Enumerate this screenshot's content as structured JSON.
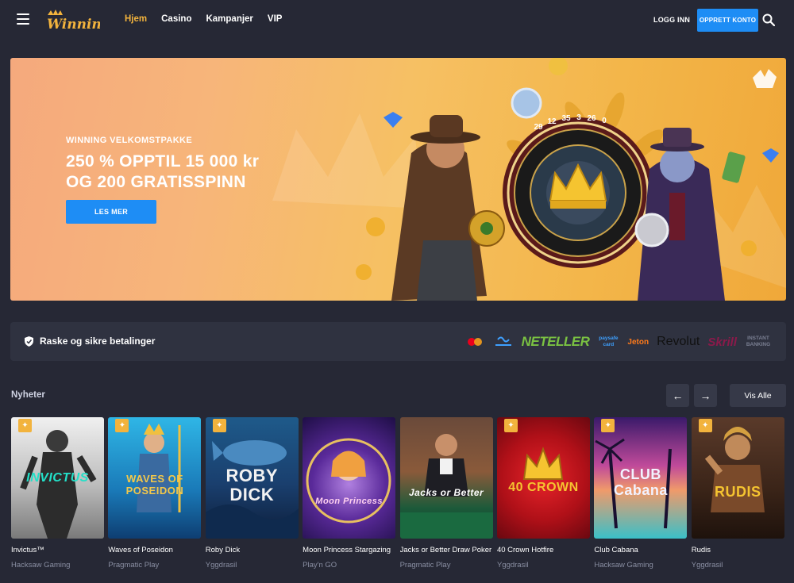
{
  "header": {
    "logo_text": "Winning",
    "nav": [
      {
        "label": "Hjem",
        "active": true
      },
      {
        "label": "Casino",
        "active": false
      },
      {
        "label": "Kampanjer",
        "active": false
      },
      {
        "label": "VIP",
        "active": false
      }
    ],
    "login_label": "LOGG INN",
    "signup_label": "OPPRETT KONTO"
  },
  "hero": {
    "subtitle": "WINNING VELKOMSTPAKKE",
    "title_line1": "250 % OPPTIL 15 000 kr",
    "title_line2": "OG 200 GRATISSPINN",
    "button_label": "LES MER",
    "roulette_numbers": [
      "29",
      "12",
      "35",
      "3",
      "26",
      "0"
    ]
  },
  "payments": {
    "label": "Raske og sikre betalinger",
    "logos": [
      "NETELLER",
      "paysafe card",
      "Jeton",
      "Revolut",
      "Skrill",
      "INSTANT BANKING"
    ]
  },
  "section": {
    "title": "Nyheter",
    "prev_icon": "←",
    "next_icon": "→",
    "view_all": "Vis Alle"
  },
  "games": [
    {
      "name": "Invictus™",
      "provider": "Hacksaw Gaming",
      "thumb_text": "INVICTUS"
    },
    {
      "name": "Waves of Poseidon",
      "provider": "Pragmatic Play",
      "thumb_text": "WAVES OF POSEIDON"
    },
    {
      "name": "Roby Dick",
      "provider": "Yggdrasil",
      "thumb_text": "ROBY DICK"
    },
    {
      "name": "Moon Princess Stargazing",
      "provider": "Play'n GO",
      "thumb_text": "Moon Princess"
    },
    {
      "name": "Jacks or Better Draw Poker",
      "provider": "Pragmatic Play",
      "thumb_text": "Jacks or Better"
    },
    {
      "name": "40 Crown Hotfire",
      "provider": "Yggdrasil",
      "thumb_text": "40 CROWN"
    },
    {
      "name": "Club Cabana",
      "provider": "Hacksaw Gaming",
      "thumb_text": "CLUB Cabana"
    },
    {
      "name": "Rudis",
      "provider": "Yggdrasil",
      "thumb_text": "RUDIS"
    }
  ]
}
